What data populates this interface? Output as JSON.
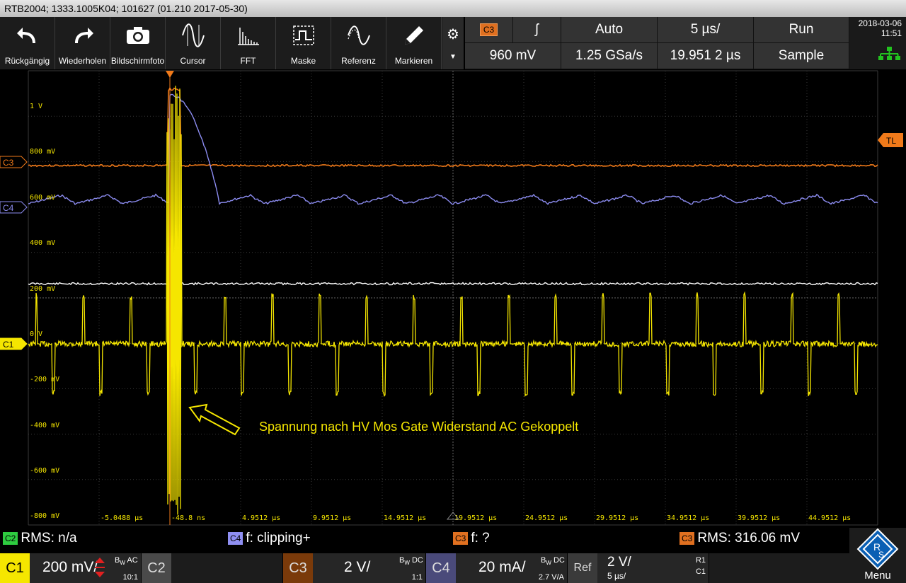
{
  "title": "RTB2004; 1333.1005K04; 101627 (01.210 2017-05-30)",
  "toolbar": [
    {
      "label": "Rückgängig",
      "icon": "undo-icon"
    },
    {
      "label": "Wiederholen",
      "icon": "redo-icon"
    },
    {
      "label": "Bildschirmfoto",
      "icon": "camera-icon"
    },
    {
      "label": "Cursor",
      "icon": "cursor-wave-icon"
    },
    {
      "label": "FFT",
      "icon": "fft-icon"
    },
    {
      "label": "Maske",
      "icon": "mask-icon"
    },
    {
      "label": "Referenz",
      "icon": "reference-wave-icon"
    },
    {
      "label": "Markieren",
      "icon": "pencil-icon"
    }
  ],
  "status": {
    "trigger_source": "C3",
    "trigger_slope": "ʃ",
    "trigger_mode": "Auto",
    "timebase": "5 µs/",
    "run_state": "Run",
    "trigger_level": "960 mV",
    "sample_rate": "1.25 GSa/s",
    "trigger_offset": "19.951 2 µs",
    "acq_mode": "Sample"
  },
  "date": "2018-03-06",
  "time": "11:51",
  "grid": {
    "channel_markers": [
      "C3",
      "C4",
      "C1"
    ],
    "trigger_level_marker": "TL",
    "y_labels": [
      "1 V",
      "800 mV",
      "600 mV",
      "400 mV",
      "200 mV",
      "0 V",
      "-200 mV",
      "-400 mV",
      "-600 mV",
      "-800 mV"
    ],
    "x_labels": [
      "-5.0488 µs",
      "-48.8 ns",
      "4.9512 µs",
      "9.9512 µs",
      "14.9512 µs",
      "19.9512 µs",
      "24.9512 µs",
      "29.9512 µs",
      "34.9512 µs",
      "39.9512 µs",
      "44.9512 µs"
    ],
    "annotation": "Spannung nach HV Mos Gate Widerstand AC Gekoppelt"
  },
  "measurements": [
    {
      "tag": "C2",
      "text": "RMS: n/a",
      "color": "#2ecc40"
    },
    {
      "tag": "C4",
      "text": "f: clipping+",
      "color": "#8f8ff2"
    },
    {
      "tag": "C3",
      "text": "f: ?",
      "color": "#e07020"
    },
    {
      "tag": "C3",
      "text": "RMS: 316.06 mV",
      "color": "#e07020"
    }
  ],
  "channels": {
    "c1": {
      "name": "C1",
      "scale": "200 mV/",
      "bw": "AC",
      "ratio": "10:1"
    },
    "c2": {
      "name": "C2"
    },
    "c3": {
      "name": "C3",
      "scale": "2 V/",
      "bw": "DC",
      "ratio": "1:1"
    },
    "c4": {
      "name": "C4",
      "scale": "20 mA/",
      "bw": "DC",
      "ratio": "2.7 V/A"
    },
    "ref": {
      "name": "Ref",
      "scale": "2 V/",
      "time": "5 µs/",
      "r1": "R1",
      "src": "C1"
    }
  },
  "menu_label": "Menu",
  "colors": {
    "c1": "#f5e600",
    "c3": "#f07a1a",
    "c4": "#8c8cf0",
    "c2": "#2ecc40",
    "ref": "#ffffff"
  }
}
